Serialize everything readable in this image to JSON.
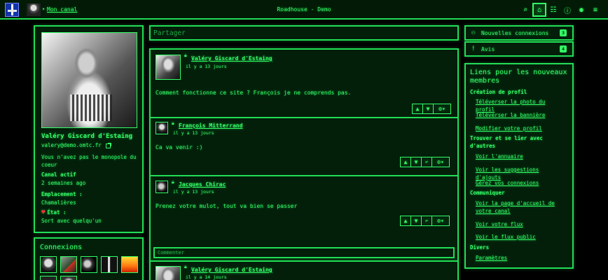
{
  "header": {
    "my_channel": "Mon canal",
    "title": "Roadhouse - Demo",
    "icons": [
      "search-icon",
      "home-icon",
      "apps-grid-icon",
      "info-icon",
      "community-icon",
      "menu-icon"
    ]
  },
  "profile": {
    "name": "Valéry Giscard d'Estaing",
    "email": "valery@demo.omtc.fr",
    "bio": "Vous n'avez pas le monopole du coeur",
    "active_label": "Canal actif",
    "active_value": "2 semaines ago",
    "location_label": "Emplacement :",
    "location_value": "Chamalières",
    "status_label": "État :",
    "status_value": "Sort avec quelqu'un"
  },
  "connections": {
    "title": "Connexions"
  },
  "share": {
    "placeholder": "Partager"
  },
  "posts": [
    {
      "author": "Valéry Giscard d'Estaing",
      "time": "il y a 13 jours",
      "body": "Comment fonctionne ce site ? François je ne comprends pas.",
      "replies": [
        {
          "author": "François Mitterrand",
          "time": "il y a 13 jours",
          "body": "Ca va venir :)"
        },
        {
          "author": "Jacques Chirac",
          "time": "il y a 13 jours",
          "body": "Prenez votre mulot, tout va bien se passer"
        }
      ],
      "comment_placeholder": "Commenter"
    },
    {
      "author": "Valéry Giscard d'Estaing",
      "time": "il y a 14 jours"
    }
  ],
  "notifications": [
    {
      "label": "Nouvelles connexions",
      "count": "3",
      "icon": "users-icon"
    },
    {
      "label": "Avis",
      "count": "4",
      "icon": "exclamation-icon"
    }
  ],
  "new_member_links": {
    "title": "Liens pour les nouveaux membres",
    "sections": [
      {
        "title": "Création de profil",
        "links": [
          "Téléverser la photo du profil",
          "Téléverser la bannière",
          "Modifier votre profil"
        ]
      },
      {
        "title": "Trouver et se lier avec d'autres",
        "links": [
          "Voir l'annuaire",
          "Voir les suggestions d'ajouts",
          "Gérez vos connexions"
        ]
      },
      {
        "title": "Communiquer",
        "links": [
          "Voir la page d'accueil de votre canal",
          "Voir votre flux",
          "Voir le flux public"
        ]
      },
      {
        "title": "Divers",
        "links": [
          "Paramètres"
        ]
      }
    ]
  }
}
